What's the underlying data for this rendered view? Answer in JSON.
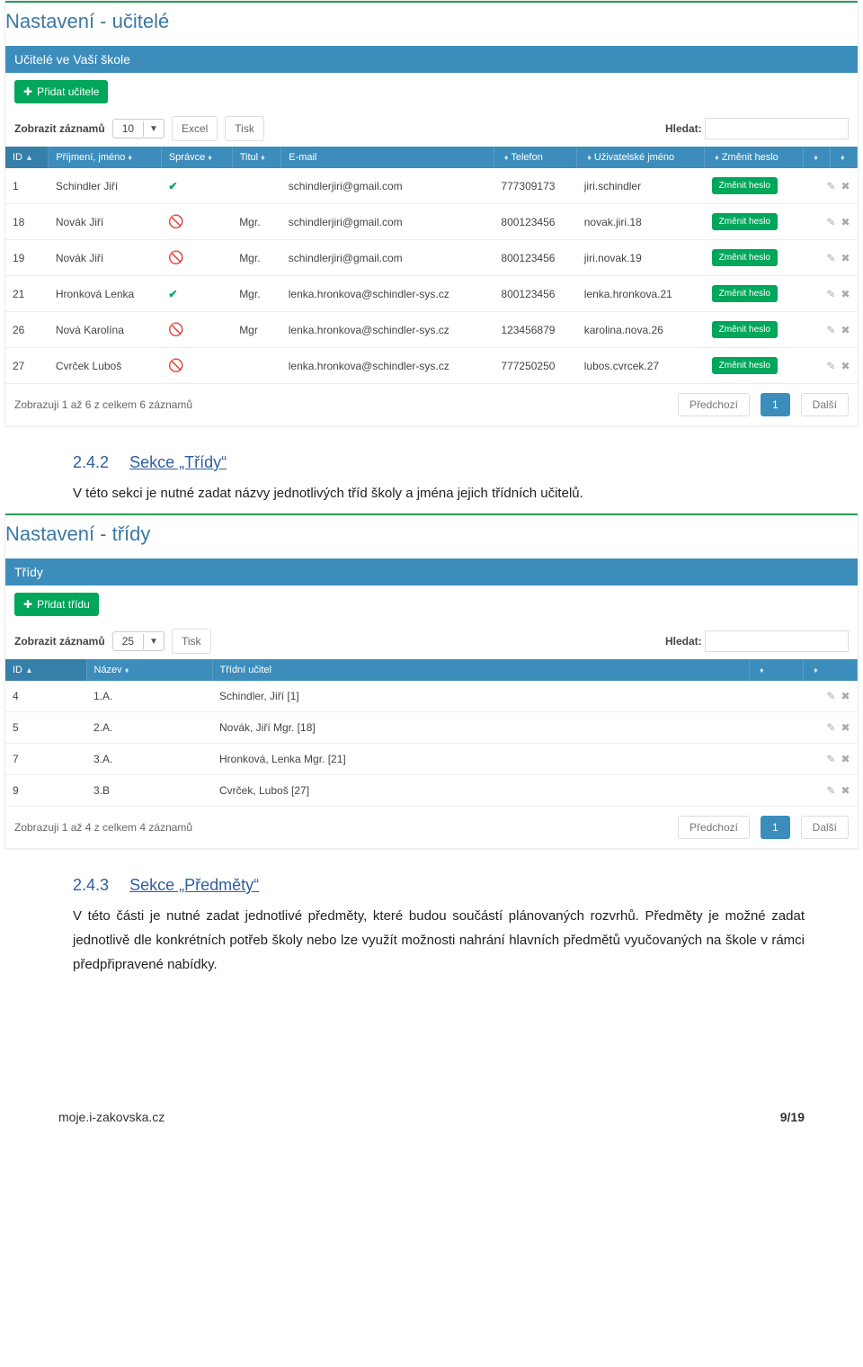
{
  "teachers": {
    "pageTitle": "Nastavení - učitelé",
    "panelTitle": "Učitelé ve Vaší škole",
    "addBtn": "Přidat učitele",
    "showLabel": "Zobrazit záznamů",
    "showCount": "10",
    "btnExcel": "Excel",
    "btnPrint": "Tisk",
    "searchLabel": "Hledat:",
    "cols": {
      "id": "ID",
      "name": "Příjmení, jméno",
      "admin": "Správce",
      "title": "Titul",
      "email": "E-mail",
      "phone": "Telefon",
      "user": "Uživatelské jméno",
      "pwd": "Změnit heslo"
    },
    "chgPwd": "Změnit heslo",
    "rows": [
      {
        "id": "1",
        "name": "Schindler Jiří",
        "admin": true,
        "title": "",
        "email": "schindlerjiri@gmail.com",
        "phone": "777309173",
        "user": "jiri.schindler"
      },
      {
        "id": "18",
        "name": "Novák Jiří",
        "admin": false,
        "title": "Mgr.",
        "email": "schindlerjiri@gmail.com",
        "phone": "800123456",
        "user": "novak.jiri.18"
      },
      {
        "id": "19",
        "name": "Novák Jiří",
        "admin": false,
        "title": "Mgr.",
        "email": "schindlerjiri@gmail.com",
        "phone": "800123456",
        "user": "jiri.novak.19"
      },
      {
        "id": "21",
        "name": "Hronková Lenka",
        "admin": true,
        "title": "Mgr.",
        "email": "lenka.hronkova@schindler-sys.cz",
        "phone": "800123456",
        "user": "lenka.hronkova.21"
      },
      {
        "id": "26",
        "name": "Nová Karolína",
        "admin": false,
        "title": "Mgr",
        "email": "lenka.hronkova@schindler-sys.cz",
        "phone": "123456879",
        "user": "karolina.nova.26"
      },
      {
        "id": "27",
        "name": "Cvrček Luboš",
        "admin": false,
        "title": "",
        "email": "lenka.hronkova@schindler-sys.cz",
        "phone": "777250250",
        "user": "lubos.cvrcek.27"
      }
    ],
    "summary": "Zobrazuji 1 až 6 z celkem 6 záznamů",
    "prev": "Předchozí",
    "pageNum": "1",
    "next": "Další"
  },
  "section242": {
    "num": "2.4.2",
    "title": "Sekce „Třídy“",
    "text": "V této sekci je nutné zadat názvy jednotlivých tříd školy a jména jejich třídních učitelů."
  },
  "classes": {
    "pageTitle": "Nastavení - třídy",
    "panelTitle": "Třídy",
    "addBtn": "Přidat třídu",
    "showLabel": "Zobrazit záznamů",
    "showCount": "25",
    "btnPrint": "Tisk",
    "searchLabel": "Hledat:",
    "cols": {
      "id": "ID",
      "name": "Název",
      "teacher": "Třídní učitel"
    },
    "rows": [
      {
        "id": "4",
        "name": "1.A.",
        "teacher": "Schindler, Jiří [1]"
      },
      {
        "id": "5",
        "name": "2.A.",
        "teacher": "Novák, Jiří Mgr. [18]"
      },
      {
        "id": "7",
        "name": "3.A.",
        "teacher": "Hronková, Lenka Mgr. [21]"
      },
      {
        "id": "9",
        "name": "3.B",
        "teacher": "Cvrček, Luboš [27]"
      }
    ],
    "summary": "Zobrazuji 1 až 4 z celkem 4 záznamů",
    "prev": "Předchozí",
    "pageNum": "1",
    "next": "Další"
  },
  "section243": {
    "num": "2.4.3",
    "title": "Sekce „Předměty“",
    "text": "V této části je nutné zadat jednotlivé předměty, které budou součástí plánovaných rozvrhů. Předměty je možné zadat jednotlivě dle konkrétních potřeb školy nebo lze využít možnosti nahrání hlavních předmětů vyučovaných na škole v rámci předpřipravené nabídky."
  },
  "footer": {
    "site": "moje.i-zakovska.cz",
    "page": "9/19"
  }
}
